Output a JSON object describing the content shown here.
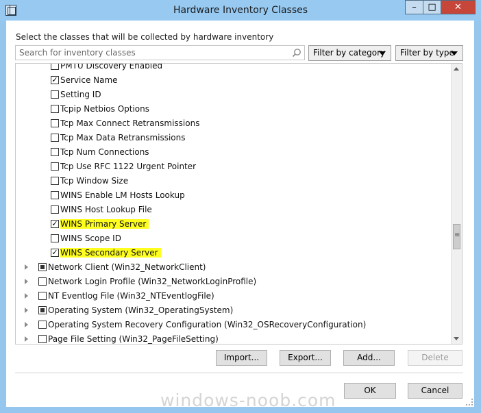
{
  "window": {
    "title": "Hardware Inventory Classes",
    "minimize_glyph": "–",
    "maximize_glyph": "□",
    "close_glyph": "✕"
  },
  "instruction": "Select the classes that will be collected by hardware inventory",
  "search": {
    "placeholder": "Search for inventory classes"
  },
  "filters": {
    "category": "Filter by category",
    "type": "Filter by type"
  },
  "tree_items": [
    {
      "label": "PMTU Discovery Enabled",
      "checked": false,
      "level": "child"
    },
    {
      "label": "Service Name",
      "checked": true,
      "level": "child"
    },
    {
      "label": "Setting ID",
      "checked": false,
      "level": "child"
    },
    {
      "label": "Tcpip Netbios Options",
      "checked": false,
      "level": "child"
    },
    {
      "label": "Tcp Max Connect Retransmissions",
      "checked": false,
      "level": "child"
    },
    {
      "label": "Tcp Max Data Retransmissions",
      "checked": false,
      "level": "child"
    },
    {
      "label": "Tcp Num Connections",
      "checked": false,
      "level": "child"
    },
    {
      "label": "Tcp Use RFC 1122 Urgent Pointer",
      "checked": false,
      "level": "child"
    },
    {
      "label": "Tcp Window Size",
      "checked": false,
      "level": "child"
    },
    {
      "label": "WINS Enable LM Hosts Lookup",
      "checked": false,
      "level": "child"
    },
    {
      "label": "WINS Host Lookup File",
      "checked": false,
      "level": "child"
    },
    {
      "label": "WINS Primary Server",
      "checked": true,
      "level": "child",
      "highlight": true
    },
    {
      "label": "WINS Scope ID",
      "checked": false,
      "level": "child"
    },
    {
      "label": "WINS Secondary Server",
      "checked": true,
      "level": "child",
      "highlight": true
    },
    {
      "label": "Network Client (Win32_NetworkClient)",
      "checked": "partial",
      "level": "parent"
    },
    {
      "label": "Network Login Profile (Win32_NetworkLoginProfile)",
      "checked": false,
      "level": "parent"
    },
    {
      "label": "NT Eventlog File (Win32_NTEventlogFile)",
      "checked": false,
      "level": "parent"
    },
    {
      "label": "Operating System (Win32_OperatingSystem)",
      "checked": "partial",
      "level": "parent"
    },
    {
      "label": "Operating System Recovery Configuration (Win32_OSRecoveryConfiguration)",
      "checked": false,
      "level": "parent"
    },
    {
      "label": "Page File Setting (Win32_PageFileSetting)",
      "checked": false,
      "level": "parent"
    }
  ],
  "buttons": {
    "import": "Import...",
    "export": "Export...",
    "add": "Add...",
    "delete": "Delete",
    "ok": "OK",
    "cancel": "Cancel"
  },
  "watermark": "windows-noob.com",
  "colors": {
    "highlight": "#ffff1f",
    "titlebar": "#97c9f1",
    "close": "#c7463a"
  },
  "icons": {
    "search": "magnifier-icon",
    "app": "window-icon"
  }
}
